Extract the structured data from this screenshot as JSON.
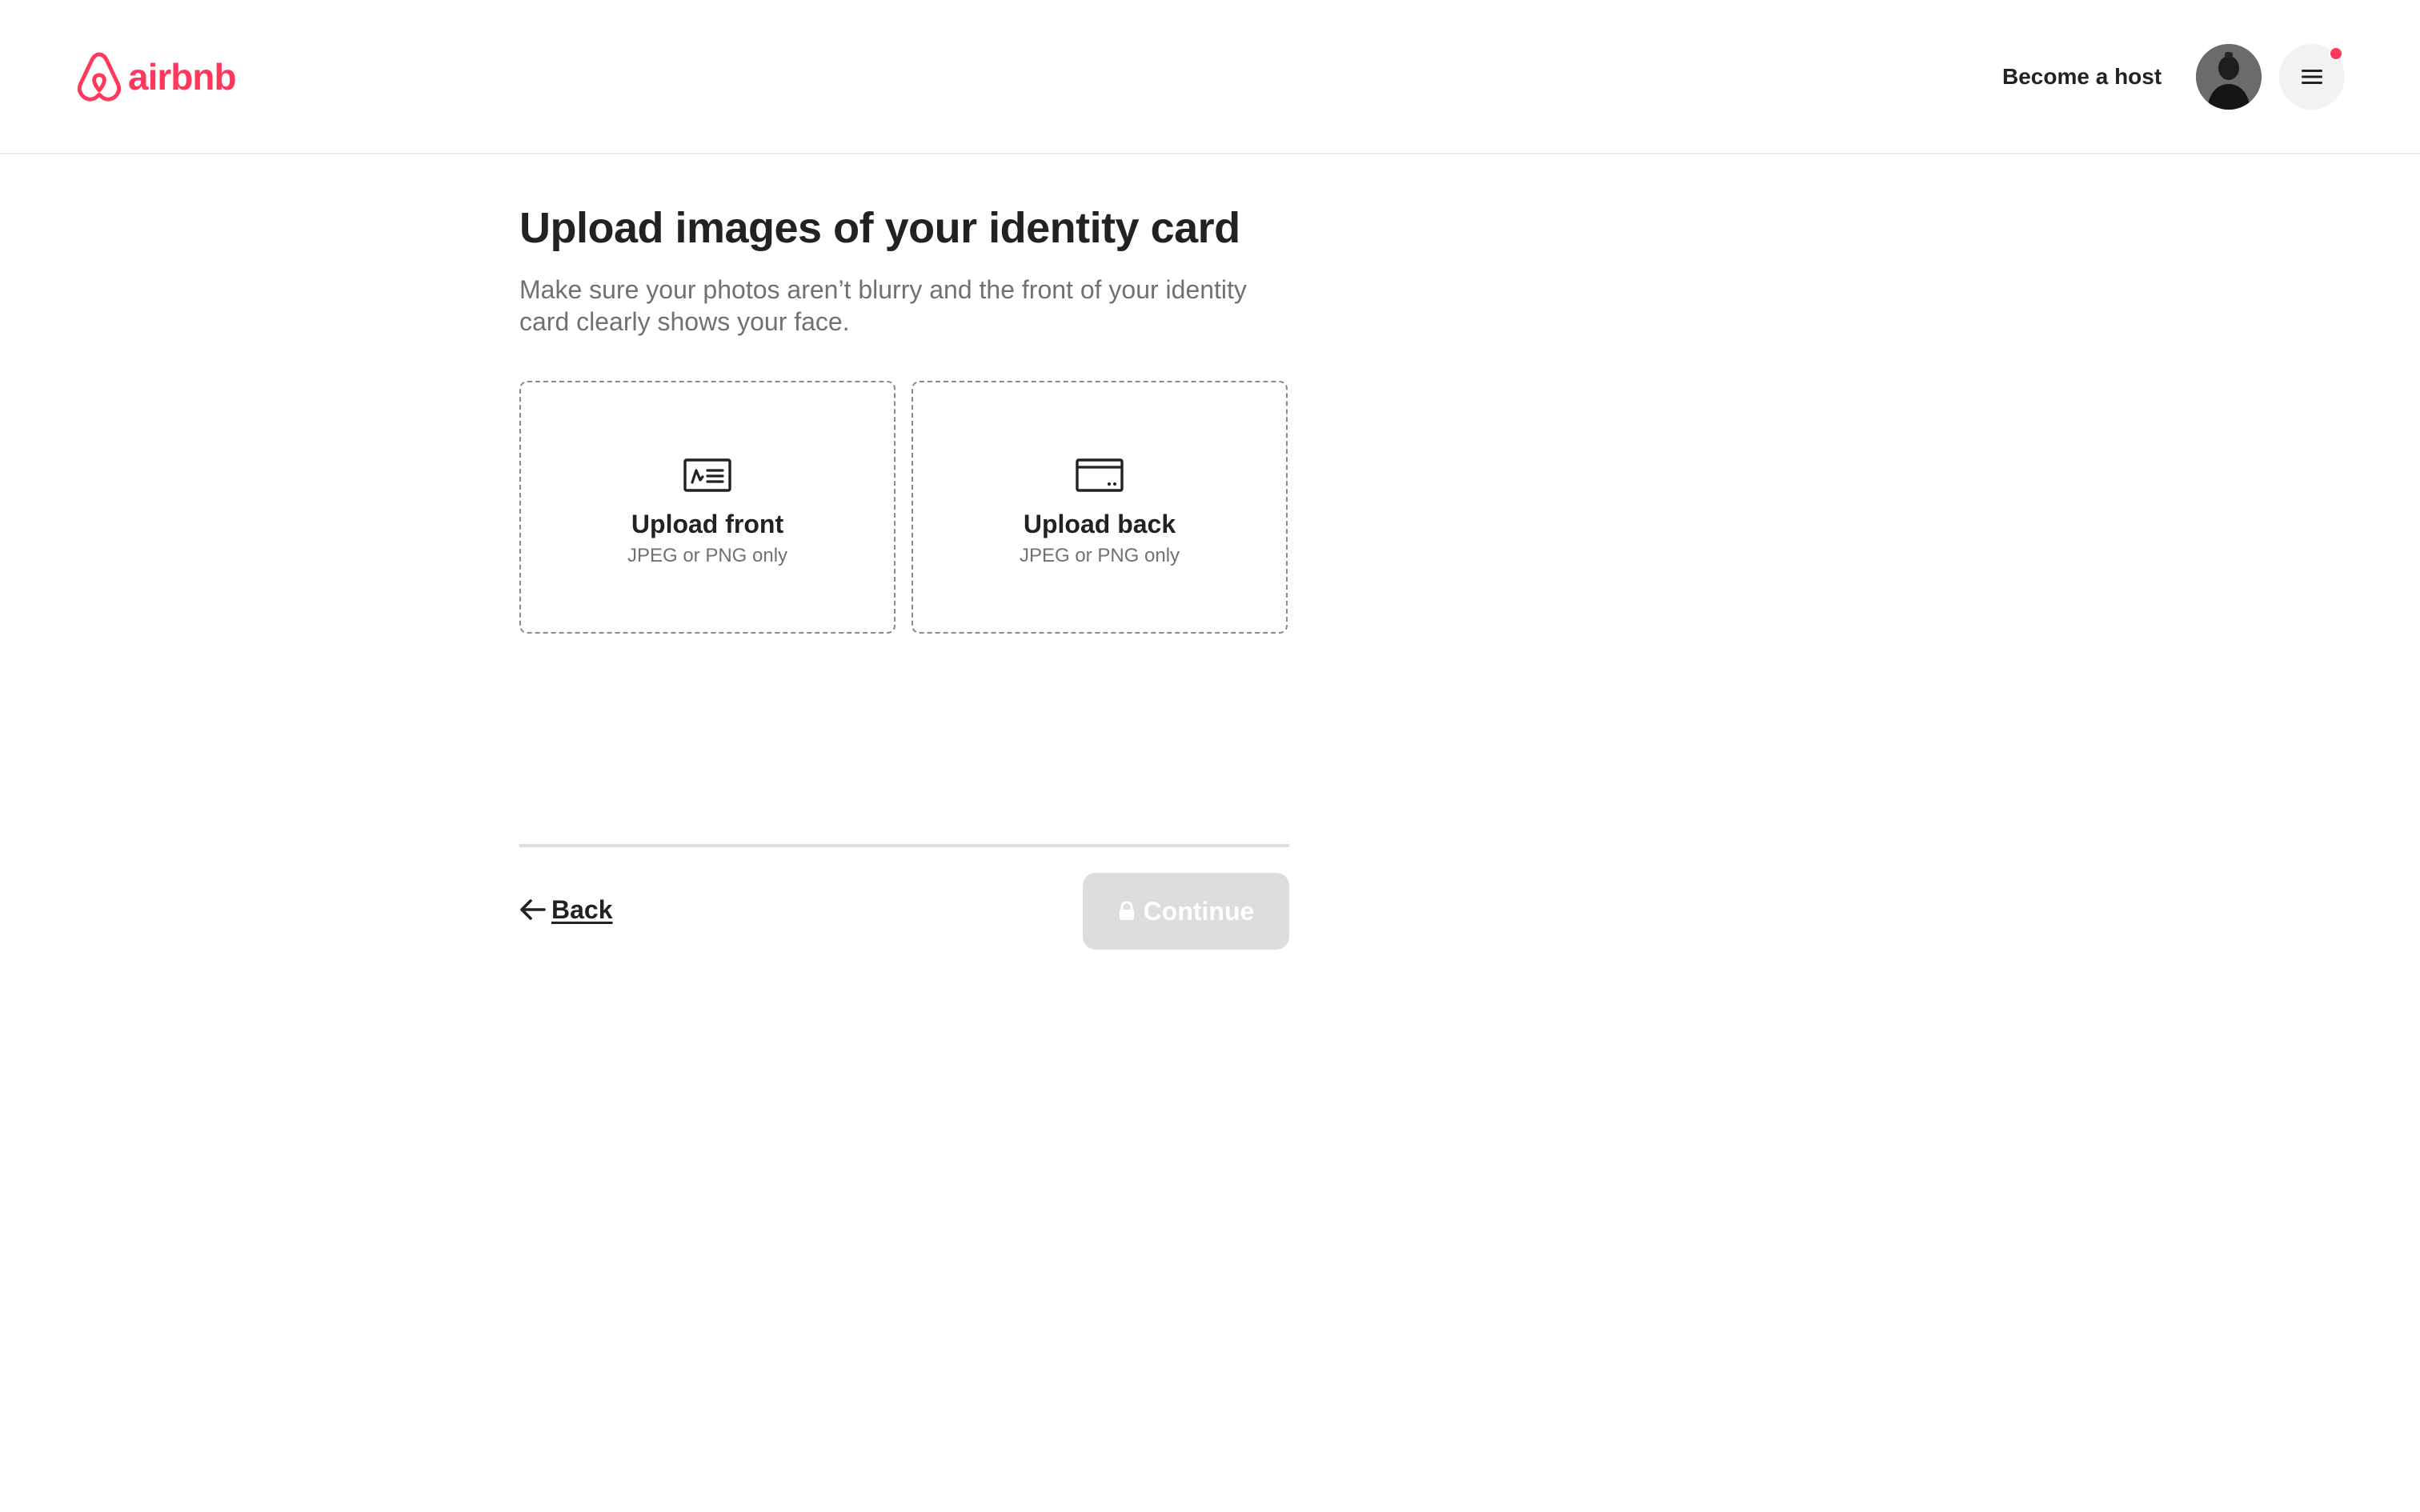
{
  "header": {
    "logo_text": "airbnb",
    "become_host_label": "Become a host",
    "has_notification": true
  },
  "main": {
    "title": "Upload images of your identity card",
    "subtitle": "Make sure your photos aren’t blurry and the front of your identity card clearly shows your face.",
    "uploads": [
      {
        "label": "Upload front",
        "hint": "JPEG or PNG only",
        "icon": "id-card-front-icon"
      },
      {
        "label": "Upload back",
        "hint": "JPEG or PNG only",
        "icon": "id-card-back-icon"
      }
    ]
  },
  "footer": {
    "back_label": "Back",
    "continue_label": "Continue",
    "continue_disabled": true
  },
  "colors": {
    "brand": "#ff385c",
    "text_primary": "#222222",
    "text_secondary": "#717171",
    "disabled_button": "#dddddd"
  }
}
